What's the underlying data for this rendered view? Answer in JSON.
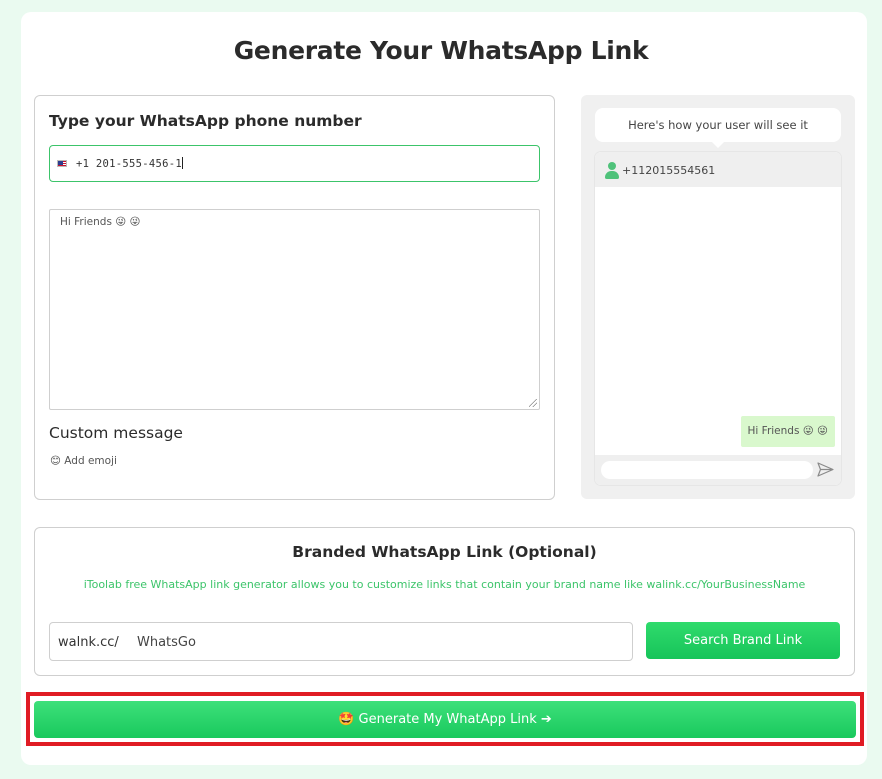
{
  "page": {
    "title": "Generate Your WhatsApp Link"
  },
  "form": {
    "phone_label": "Type your WhatsApp phone number",
    "phone_value": "+1  201-555-456-1",
    "message_value": "Hi Friends 😜 😜",
    "custom_label": "Custom message",
    "add_emoji": "😊 Add emoji"
  },
  "preview": {
    "caption": "Here's how your user will see it",
    "number": "+112015554561",
    "message": "Hi Friends 😜 😜"
  },
  "brand": {
    "title": "Branded WhatsApp Link (Optional)",
    "description": "iToolab free WhatsApp link generator allows you to customize links that contain your brand name like walink.cc/YourBusinessName",
    "prefix": "walnk.cc/",
    "input_value": "WhatsGo",
    "search_label": "Search Brand Link"
  },
  "actions": {
    "generate_label": "🤩 Generate My WhatApp Link ➔"
  },
  "colors": {
    "accent": "#3cc46a",
    "button": "#1ccb5f",
    "highlight": "#e01c24"
  }
}
